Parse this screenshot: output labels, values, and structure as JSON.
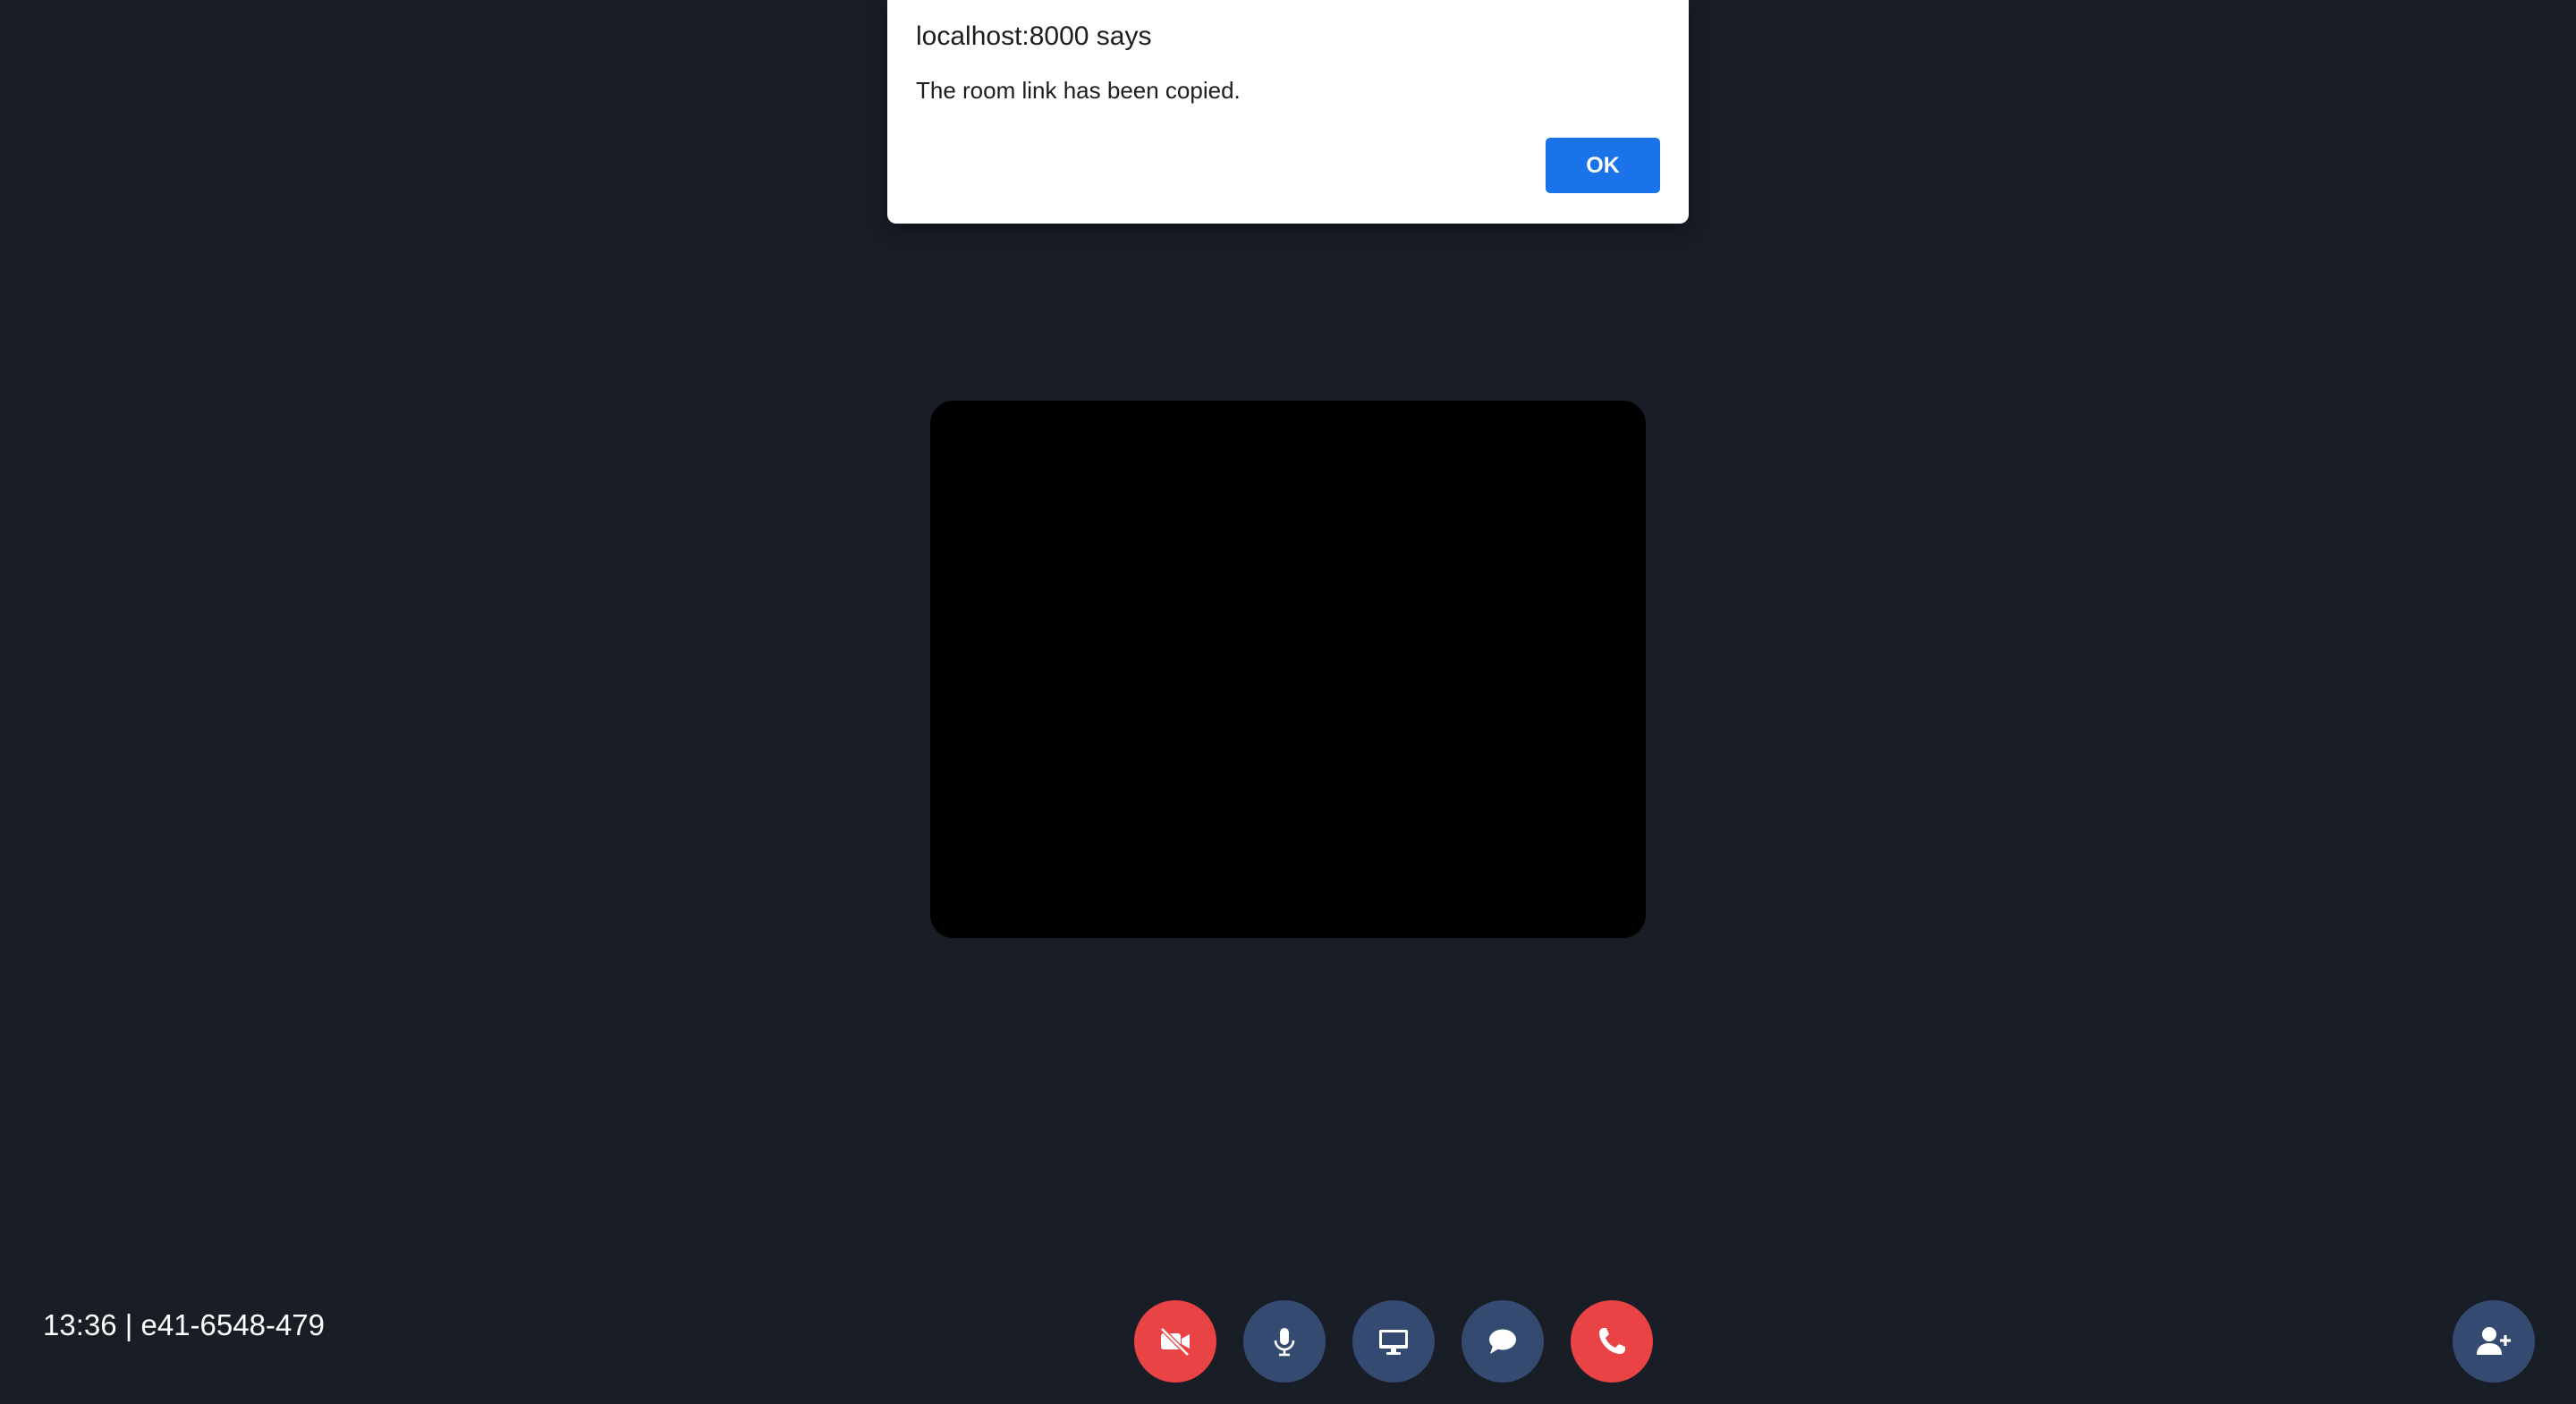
{
  "alert": {
    "title": "localhost:8000 says",
    "message": "The room link has been copied.",
    "ok_label": "OK"
  },
  "meeting": {
    "info": "13:36 | e41-6548-479"
  },
  "controls": [
    {
      "name": "camera-off-button",
      "icon": "video-slash-icon",
      "state": "off",
      "color": "#ea4345"
    },
    {
      "name": "microphone-button",
      "icon": "microphone-icon",
      "state": "on",
      "color": "#344a70"
    },
    {
      "name": "screen-share-button",
      "icon": "desktop-icon",
      "state": "off",
      "color": "#344a70"
    },
    {
      "name": "chat-button",
      "icon": "chat-bubble-icon",
      "state": "off",
      "color": "#344a70"
    },
    {
      "name": "leave-call-button",
      "icon": "phone-icon",
      "state": "active",
      "color": "#ea4345"
    }
  ],
  "add_participant": {
    "icon": "user-plus-icon",
    "color": "#344a70"
  },
  "colors": {
    "background": "#191d26",
    "accent": "#1a73e8",
    "danger": "#ea4345",
    "control": "#344a70"
  }
}
